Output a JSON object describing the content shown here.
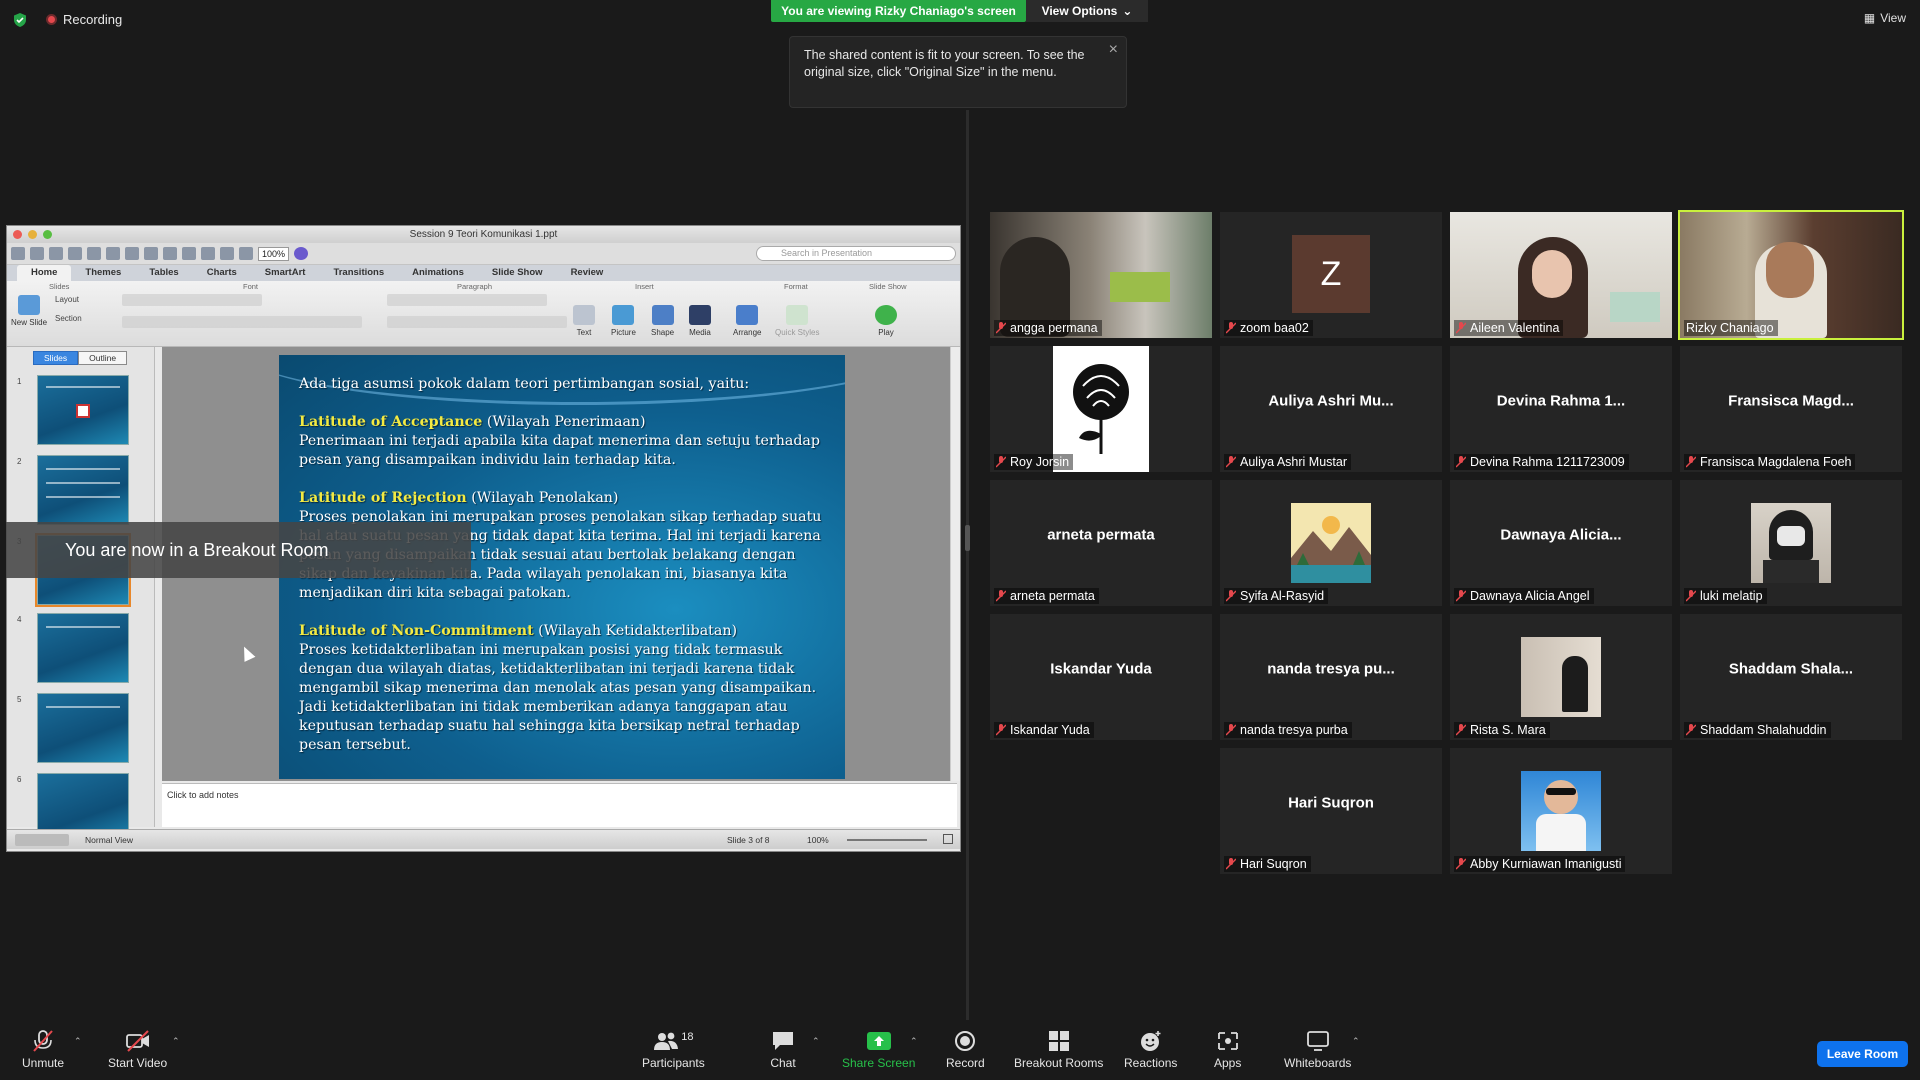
{
  "top": {
    "recording": "Recording",
    "share_banner": "You are viewing Rizky Chaniago's screen",
    "view_options": "View Options",
    "view": "View",
    "tooltip": "The shared content is fit to your screen. To see the original size, click \"Original Size\" in the menu."
  },
  "ppt": {
    "window_title": "Session 9 Teori Komunikasi 1.ppt",
    "zoom": "100%",
    "search_placeholder": "Search in Presentation",
    "tabs": [
      "Home",
      "Themes",
      "Tables",
      "Charts",
      "SmartArt",
      "Transitions",
      "Animations",
      "Slide Show",
      "Review"
    ],
    "groups": {
      "slides": "Slides",
      "font": "Font",
      "paragraph": "Paragraph",
      "insert": "Insert",
      "format": "Format",
      "slide_show": "Slide Show"
    },
    "ribbon": {
      "new_slide": "New Slide",
      "layout": "Layout",
      "section": "Section",
      "text": "Text",
      "picture": "Picture",
      "shape": "Shape",
      "media": "Media",
      "arrange": "Arrange",
      "quick_styles": "Quick Styles",
      "play": "Play"
    },
    "pane_tabs": [
      "Slides",
      "Outline"
    ],
    "thumb_numbers": [
      "1",
      "2",
      "3",
      "4",
      "5",
      "6"
    ],
    "slide": {
      "intro": "Ada tiga asumsi pokok dalam teori pertimbangan sosial, yaitu:",
      "h1": "Latitude of Acceptance",
      "h1_sub": " (Wilayah Penerimaan)",
      "p1": "Penerimaan ini terjadi apabila kita dapat menerima dan setuju terhadap pesan yang disampaikan individu lain terhadap kita.",
      "h2": "Latitude of Rejection",
      "h2_sub": " (Wilayah Penolakan)",
      "p2": "Proses penolakan ini merupakan proses penolakan sikap terhadap suatu hal atau suatu pesan yang tidak dapat kita terima. Hal ini terjadi karena pesan yang disampaikan tidak sesuai atau bertolak belakang dengan sikap dan keyakinan kita. Pada wilayah penolakan ini, biasanya kita menjadikan diri kita sebagai patokan.",
      "h3": "Latitude of Non-Commitment",
      "h3_sub": " (Wilayah Ketidakterlibatan)",
      "p3": "Proses ketidakterlibatan ini merupakan posisi yang tidak termasuk dengan dua wilayah diatas, ketidakterlibatan ini terjadi karena tidak mengambil sikap menerima dan menolak atas pesan yang disampaikan. Jadi ketidakterlibatan ini tidak memberikan adanya tanggapan atau keputusan terhadap suatu hal sehingga kita bersikap netral terhadap pesan tersebut."
    },
    "notes_placeholder": "Click to add notes",
    "status": {
      "view": "Normal View",
      "slide": "Slide 3 of 8",
      "zoom": "100%"
    }
  },
  "breakout_notice": "You are now in a Breakout Room",
  "participants": [
    {
      "label": "angga permana",
      "center": "",
      "kind": "video-desk"
    },
    {
      "label": "zoom baa02",
      "center": "",
      "kind": "avatar-z",
      "initial": "Z"
    },
    {
      "label": "Aileen Valentina",
      "center": "",
      "kind": "video-girl"
    },
    {
      "label": "Rizky Chaniago",
      "center": "",
      "kind": "video-man"
    },
    {
      "label": "Roy Jorsin",
      "center": "",
      "kind": "photo-rose"
    },
    {
      "label": "Auliya Ashri Mustar",
      "center": "Auliya Ashri Mu...",
      "kind": "name"
    },
    {
      "label": "Devina Rahma 1211723009",
      "center": "Devina Rahma 1...",
      "kind": "name"
    },
    {
      "label": "Fransisca Magdalena Foeh",
      "center": "Fransisca Magd...",
      "kind": "name"
    },
    {
      "label": "arneta permata",
      "center": "arneta permata",
      "kind": "name"
    },
    {
      "label": "Syifa Al-Rasyid",
      "center": "",
      "kind": "photo-mountain"
    },
    {
      "label": "Dawnaya Alicia Angel",
      "center": "Dawnaya Alicia...",
      "kind": "name"
    },
    {
      "label": "luki melatip",
      "center": "",
      "kind": "photo-mask"
    },
    {
      "label": "Iskandar Yuda",
      "center": "Iskandar Yuda",
      "kind": "name"
    },
    {
      "label": "nanda tresya purba",
      "center": "nanda tresya pu...",
      "kind": "name"
    },
    {
      "label": "Rista S. Mara",
      "center": "",
      "kind": "photo-mirror"
    },
    {
      "label": "Shaddam Shalahuddin",
      "center": "Shaddam Shala...",
      "kind": "name"
    },
    {
      "label": "Hari Suqron",
      "center": "Hari Suqron",
      "kind": "name"
    },
    {
      "label": "Abby Kurniawan Imanigusti",
      "center": "",
      "kind": "photo-person"
    }
  ],
  "toolbar": {
    "unmute": "Unmute",
    "start_video": "Start Video",
    "participants": "Participants",
    "participants_count": "18",
    "chat": "Chat",
    "share_screen": "Share Screen",
    "record": "Record",
    "breakout_rooms": "Breakout Rooms",
    "reactions": "Reactions",
    "apps": "Apps",
    "whiteboards": "Whiteboards",
    "leave": "Leave Room"
  },
  "colors": {
    "share_green": "#27a844",
    "leave_blue": "#0e72ed",
    "active_speaker": "#c9f03d",
    "muted_red": "#e5484d"
  }
}
